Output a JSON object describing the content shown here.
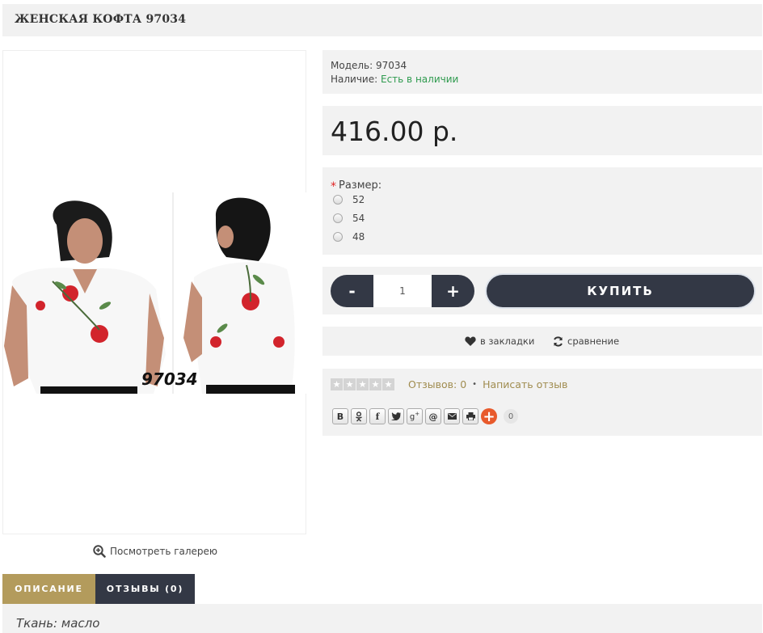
{
  "product": {
    "title": "ЖЕНСКАЯ КОФТА 97034",
    "image_label": "97034",
    "gallery_link": "Посмотреть галерею"
  },
  "info": {
    "model_label": "Модель:",
    "model_value": "97034",
    "stock_label": "Наличие:",
    "stock_value": "Есть в наличии"
  },
  "price": "416.00 р.",
  "options": {
    "required_mark": "*",
    "title": "Размер:",
    "sizes": [
      "52",
      "54",
      "48"
    ]
  },
  "buy": {
    "minus": "-",
    "plus": "+",
    "quantity": "1",
    "button": "КУПИТЬ"
  },
  "links": {
    "wishlist": "в закладки",
    "compare": "сравнение"
  },
  "reviews": {
    "count_text": "Отзывов: 0",
    "separator": "•",
    "write": "Написать отзыв",
    "rating": 0,
    "max_rating": 5
  },
  "share": {
    "buttons": [
      "В",
      "ok",
      "f",
      "tw",
      "g+",
      "@",
      "mail",
      "print"
    ],
    "count": "0"
  },
  "tabs": {
    "description": "ОПИСАНИЕ",
    "reviews": "ОТЗЫВЫ (0)"
  },
  "description_text": "Ткань: масло",
  "colors": {
    "panel_bg": "#f2f2f2",
    "dark_button": "#333845",
    "gold_tab": "#b39b5c",
    "stock_green": "#2e9a4e",
    "review_link": "#a08c4f",
    "share_plus": "#e85a2c"
  }
}
